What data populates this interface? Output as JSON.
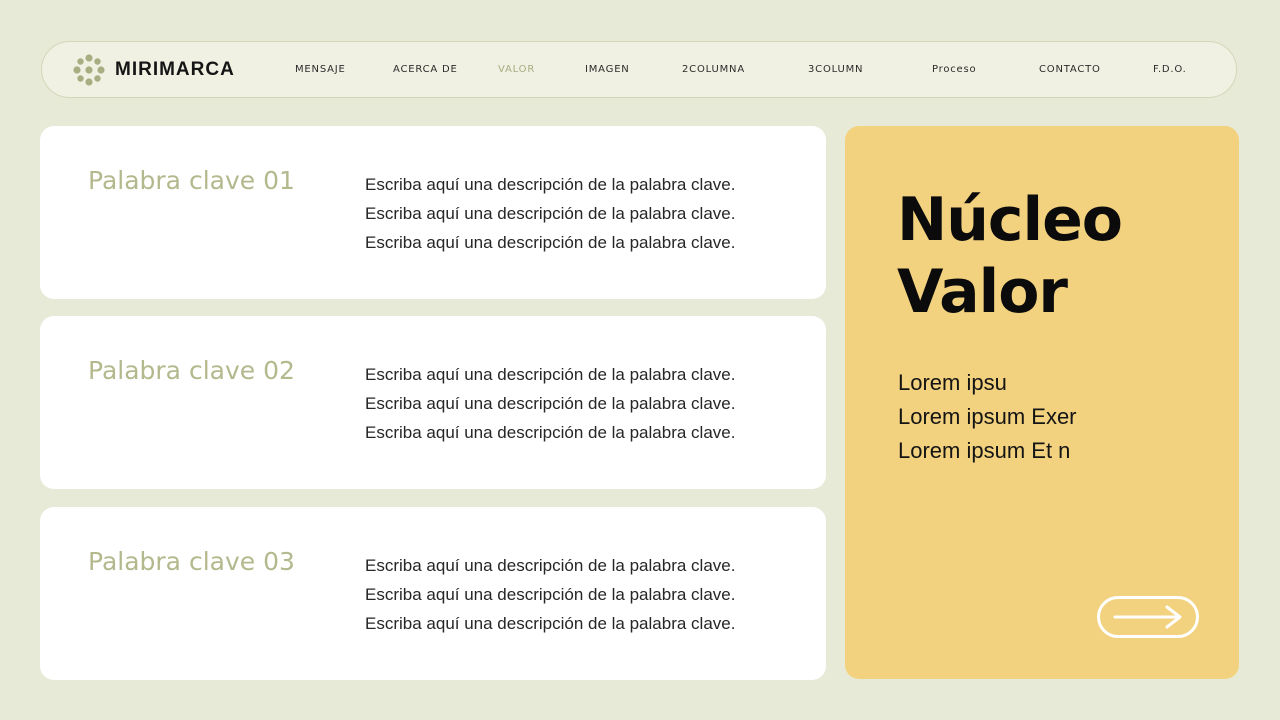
{
  "brand": {
    "name": "MIRIMARCA",
    "logo_icon": "flower-dots-icon",
    "logo_color": "#a8ad82"
  },
  "nav": {
    "items": [
      {
        "label": "MENSAJE",
        "active": false
      },
      {
        "label": "ACERCA DE",
        "active": false
      },
      {
        "label": "VALOR",
        "active": true
      },
      {
        "label": "IMAGEN",
        "active": false
      },
      {
        "label": "2COLUMNA",
        "active": false
      },
      {
        "label": "3COLUMN",
        "active": false
      },
      {
        "label": "Proceso",
        "active": false
      },
      {
        "label": "CONTACTO",
        "active": false
      },
      {
        "label": "F.D.O.",
        "active": false
      }
    ]
  },
  "cards": [
    {
      "title": "Palabra clave 01",
      "lines": [
        "Escriba aquí una descripción de la palabra clave.",
        "Escriba aquí una descripción de la palabra clave.",
        "Escriba aquí una descripción de la palabra clave."
      ]
    },
    {
      "title": "Palabra clave 02",
      "lines": [
        "Escriba aquí una descripción de la palabra clave.",
        "Escriba aquí una descripción de la palabra clave.",
        "Escriba aquí una descripción de la palabra clave."
      ]
    },
    {
      "title": "Palabra clave 03",
      "lines": [
        "Escriba aquí una descripción de la palabra clave.",
        "Escriba aquí una descripción de la palabra clave.",
        "Escriba aquí una descripción de la palabra clave."
      ]
    }
  ],
  "panel": {
    "title_line1": "Núcleo",
    "title_line2": "Valor",
    "lines": [
      "Lorem ipsu",
      "Lorem ipsum Exer",
      "Lorem ipsum Et n"
    ],
    "arrow_icon": "arrow-right-icon"
  },
  "colors": {
    "background": "#e8ead8",
    "accent_olive": "#b4b88d",
    "panel_yellow": "#f3d27f",
    "card_white": "#ffffff"
  }
}
